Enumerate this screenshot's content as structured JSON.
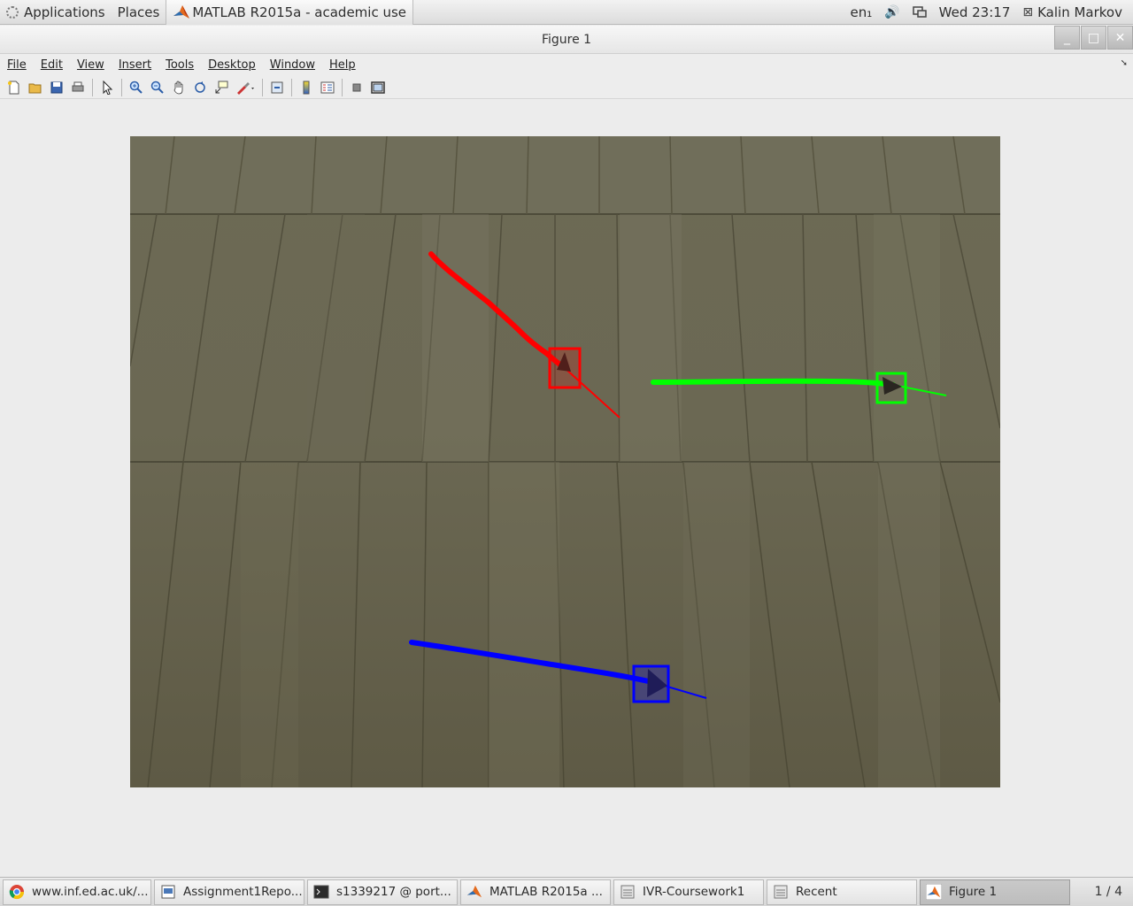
{
  "top_panel": {
    "applications": "Applications",
    "places": "Places",
    "active_window": "MATLAB R2015a - academic use",
    "input_method": "en₁",
    "clock": "Wed 23:17",
    "user": "Kalin Markov"
  },
  "window": {
    "title": "Figure 1"
  },
  "menu": {
    "file": "File",
    "edit": "Edit",
    "view": "View",
    "insert": "Insert",
    "tools": "Tools",
    "desktop": "Desktop",
    "window": "Window",
    "help": "Help"
  },
  "toolbar": {
    "icons": [
      "new-figure-icon",
      "open-file-icon",
      "save-figure-icon",
      "print-figure-icon",
      "edit-plot-icon",
      "zoom-in-icon",
      "zoom-out-icon",
      "pan-icon",
      "rotate-3d-icon",
      "data-cursor-icon",
      "brush-icon",
      "link-plot-icon",
      "insert-colorbar-icon",
      "insert-legend-icon",
      "hide-plot-tools-icon",
      "show-plot-tools-icon"
    ]
  },
  "figure": {
    "tracks": [
      {
        "color": "#ff0000",
        "label": "red-track"
      },
      {
        "color": "#00ff00",
        "label": "green-track"
      },
      {
        "color": "#0000ff",
        "label": "blue-track"
      }
    ]
  },
  "taskbar": {
    "tasks": [
      {
        "label": "www.inf.ed.ac.uk/...",
        "icon": "chrome-icon"
      },
      {
        "label": "Assignment1Repo...",
        "icon": "document-icon"
      },
      {
        "label": "s1339217 @ port...",
        "icon": "terminal-icon"
      },
      {
        "label": "MATLAB R2015a ...",
        "icon": "matlab-icon"
      },
      {
        "label": "IVR-Coursework1",
        "icon": "folder-icon"
      },
      {
        "label": "Recent",
        "icon": "folder-icon"
      },
      {
        "label": "Figure 1",
        "icon": "matlab-icon"
      }
    ],
    "workspace": "1 / 4"
  }
}
